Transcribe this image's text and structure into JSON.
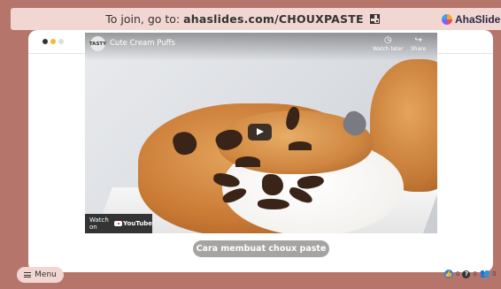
{
  "topbar": {
    "join_prefix": "To join, go to: ",
    "join_url": "ahaslides.com/CHOUXPASTE"
  },
  "brand": {
    "name": "AhaSlides"
  },
  "window_dots": {
    "colors": [
      "#333333",
      "#f5b731",
      "#dddddd"
    ]
  },
  "video": {
    "channel_initials": "TASTY",
    "title": "Cute Cream Puffs",
    "watch_later_label": "Watch later",
    "share_label": "Share",
    "watch_on_label": "Watch on",
    "youtube_label": "YouTube"
  },
  "caption": "Cara membuat choux paste",
  "menu": {
    "label": "Menu"
  },
  "reactions": {
    "likes": "0",
    "questions": "0",
    "audience": "0"
  },
  "colors": {
    "background": "#b5756a",
    "topbar": "#f2d6d1",
    "accent": "#2f7de1"
  },
  "icons": {
    "qr": "qr-code-icon",
    "logo": "ahaslides-logo-icon",
    "menu": "hamburger-icon",
    "like": "thumb-up-icon",
    "question": "question-icon",
    "audience": "people-icon",
    "clock": "clock-icon",
    "share": "share-icon",
    "play": "play-icon"
  }
}
